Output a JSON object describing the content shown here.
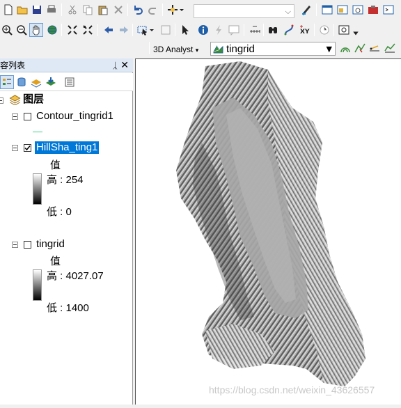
{
  "toolbar": {
    "row1_icons": [
      "new-icon",
      "open-icon",
      "save-icon",
      "print-icon",
      "cut-icon",
      "copy-icon",
      "paste-icon",
      "delete-icon",
      "undo-icon",
      "redo-icon",
      "add-data-icon",
      "scale-combo",
      "editor-icon",
      "table-icon",
      "catalog-icon",
      "search-window-icon",
      "toolbox-icon",
      "python-icon"
    ],
    "scale_value": ""
  },
  "analyst": {
    "label": "3D Analyst",
    "layer_value": "tingrid"
  },
  "toc": {
    "title": "内容列表",
    "pin": "ᚿ",
    "close": "✕",
    "root_label": "图层",
    "layers": [
      {
        "name": "Contour_tingrid1",
        "checked": false
      },
      {
        "name": "HillSha_ting1",
        "checked": true,
        "selected": true,
        "legend_header": "值",
        "high": "高 : 254",
        "low": "低 : 0"
      },
      {
        "name": "tingrid",
        "checked": false,
        "legend_header": "值",
        "high": "高 : 4027.07",
        "low": "低 : 1400"
      }
    ]
  },
  "watermark": "https://blog.csdn.net/weixin_43626557"
}
